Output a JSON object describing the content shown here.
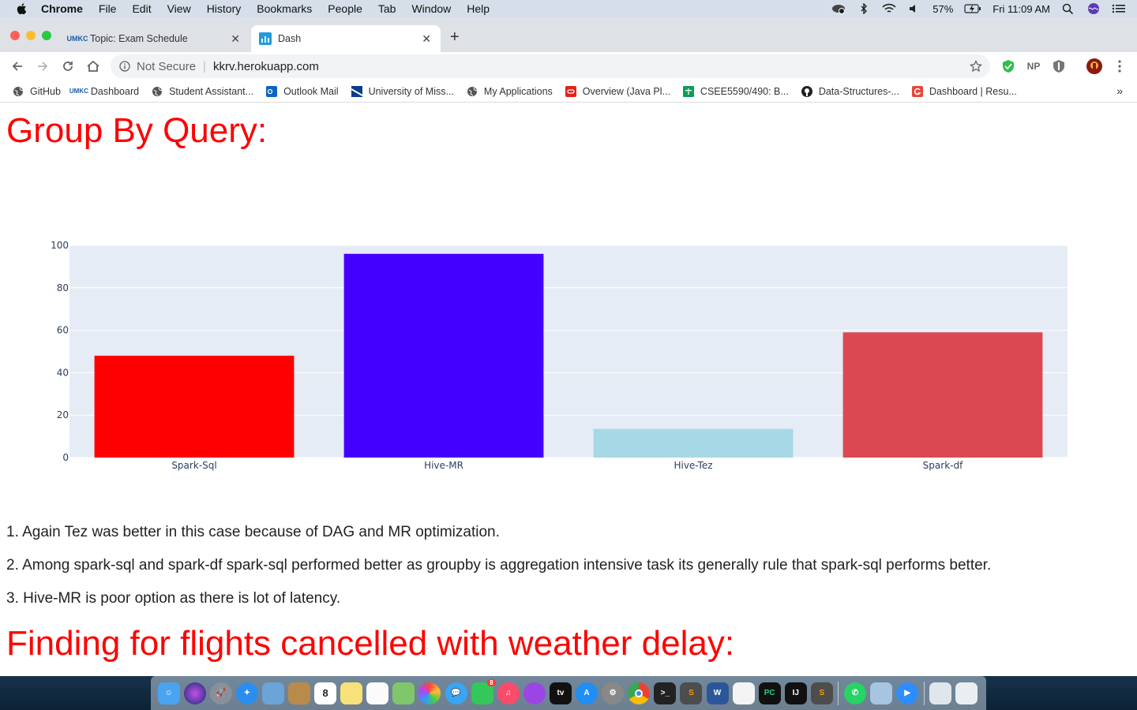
{
  "menubar": {
    "app_name": "Chrome",
    "menus": [
      "File",
      "Edit",
      "View",
      "History",
      "Bookmarks",
      "People",
      "Tab",
      "Window",
      "Help"
    ],
    "battery": "57%",
    "clock": "Fri 11:09 AM"
  },
  "tabs": [
    {
      "title": "Topic: Exam Schedule",
      "icon": "umkc-logo-icon",
      "active": false
    },
    {
      "title": "Dash",
      "icon": "dash-chart-icon",
      "active": true
    }
  ],
  "toolbar": {
    "security_label": "Not Secure",
    "url": "kkrv.herokuapp.com",
    "ext_np_label": "NP"
  },
  "bookmarks": [
    {
      "label": "GitHub",
      "icon": "globe-icon"
    },
    {
      "label": "Dashboard",
      "icon": "umkc-logo-icon"
    },
    {
      "label": "Student Assistant...",
      "icon": "globe-icon"
    },
    {
      "label": "Outlook Mail",
      "icon": "outlook-icon"
    },
    {
      "label": "University of Miss...",
      "icon": "umsystem-icon"
    },
    {
      "label": "My Applications",
      "icon": "globe-icon"
    },
    {
      "label": "Overview (Java Pl...",
      "icon": "oracle-icon"
    },
    {
      "label": "CSEE5590/490: B...",
      "icon": "sheets-icon"
    },
    {
      "label": "Data-Structures-...",
      "icon": "github-icon"
    },
    {
      "label": "Dashboard | Resu...",
      "icon": "resume-icon"
    }
  ],
  "page": {
    "heading1": "Group By Query:",
    "findings": [
      "1. Again Tez was better in this case because of DAG and MR optimization.",
      "2. Among spark-sql and spark-df spark-sql performed better as groupby is aggregation intensive task its generally rule that spark-sql performs better.",
      "3. Hive-MR is poor option as there is lot of latency."
    ],
    "heading2": "Finding for flights cancelled with weather delay:"
  },
  "chart_data": {
    "type": "bar",
    "categories": [
      "Spark-Sql",
      "Hive-MR",
      "Hive-Tez",
      "Spark-df"
    ],
    "values": [
      48,
      96,
      13.5,
      59
    ],
    "colors": [
      "#ff0000",
      "#4400ff",
      "#a6d8e6",
      "#dc4851"
    ],
    "ylim": [
      0,
      100
    ],
    "yticks": [
      0,
      20,
      40,
      60,
      80,
      100
    ],
    "grid": true,
    "plot_background": "#e5ecf6"
  },
  "dock": {
    "apps": [
      "finder-icon",
      "siri-icon",
      "launchpad-icon",
      "safari-icon",
      "preview-icon",
      "notes-book-icon",
      "calendar-icon",
      "stickies-icon",
      "reminders-icon",
      "maps-icon",
      "photos-icon",
      "messages-icon",
      "facetime-icon",
      "music-icon",
      "podcasts-icon",
      "apple-tv-icon",
      "app-store-icon",
      "system-preferences-icon",
      "chrome-icon",
      "terminal-icon",
      "sublime-text-icon",
      "word-icon",
      "textedit-icon",
      "pycharm-icon",
      "intellij-icon",
      "sublime-text-2-icon",
      "whatsapp-icon",
      "image-capture-icon",
      "zoom-icon",
      "downloads-icon",
      "trash-icon"
    ],
    "calendar_day": "8",
    "facetime_badge": "8"
  }
}
